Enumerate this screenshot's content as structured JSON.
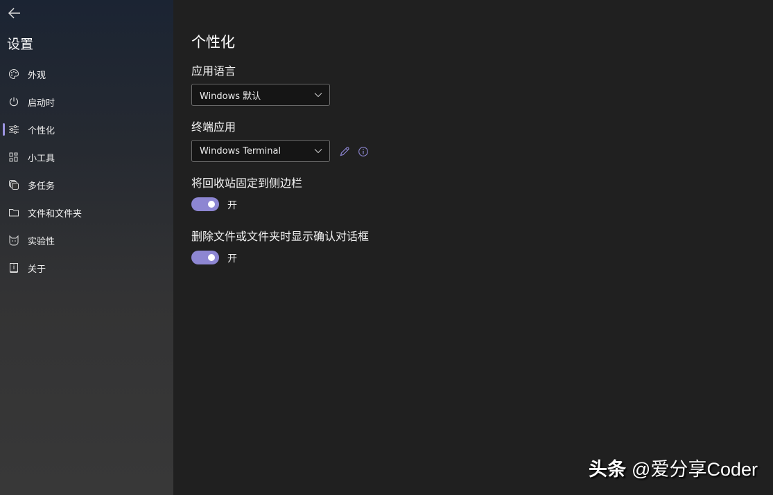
{
  "sidebar": {
    "title": "设置",
    "items": [
      {
        "label": "外观",
        "icon": "palette-icon"
      },
      {
        "label": "启动时",
        "icon": "power-icon"
      },
      {
        "label": "个性化",
        "icon": "sliders-icon",
        "selected": true
      },
      {
        "label": "小工具",
        "icon": "widgets-icon"
      },
      {
        "label": "多任务",
        "icon": "multitask-icon"
      },
      {
        "label": "文件和文件夹",
        "icon": "folder-icon"
      },
      {
        "label": "实验性",
        "icon": "cat-icon"
      },
      {
        "label": "关于",
        "icon": "info-book-icon"
      }
    ]
  },
  "main": {
    "title": "个性化",
    "app_language": {
      "label": "应用语言",
      "value": "Windows 默认"
    },
    "terminal_app": {
      "label": "终端应用",
      "value": "Windows Terminal"
    },
    "pin_recycle": {
      "label": "将回收站固定到侧边栏",
      "state": "开",
      "on": true
    },
    "confirm_delete": {
      "label": "删除文件或文件夹时显示确认对话框",
      "state": "开",
      "on": true
    }
  },
  "watermark": {
    "brand": "头条",
    "handle": "@爱分享Coder"
  },
  "colors": {
    "accent": "#8d86d2"
  }
}
